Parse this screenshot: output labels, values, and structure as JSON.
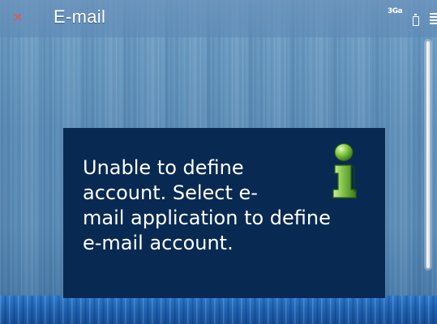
{
  "app": {
    "title": "E-mail",
    "close_icon": "close-icon"
  },
  "status": {
    "signal_label": "3Ga",
    "battery_icon": "battery-icon",
    "signal_bars_icon": "signal-bars-icon"
  },
  "dialog": {
    "icon": "info-icon",
    "lines": [
      "Unable to define",
      "account. Select e-",
      "mail application to define",
      "e-mail account."
    ]
  },
  "colors": {
    "dialog_bg": "#082a52",
    "info_icon_green": "#7ac143",
    "close_icon": "#e05a4a"
  }
}
